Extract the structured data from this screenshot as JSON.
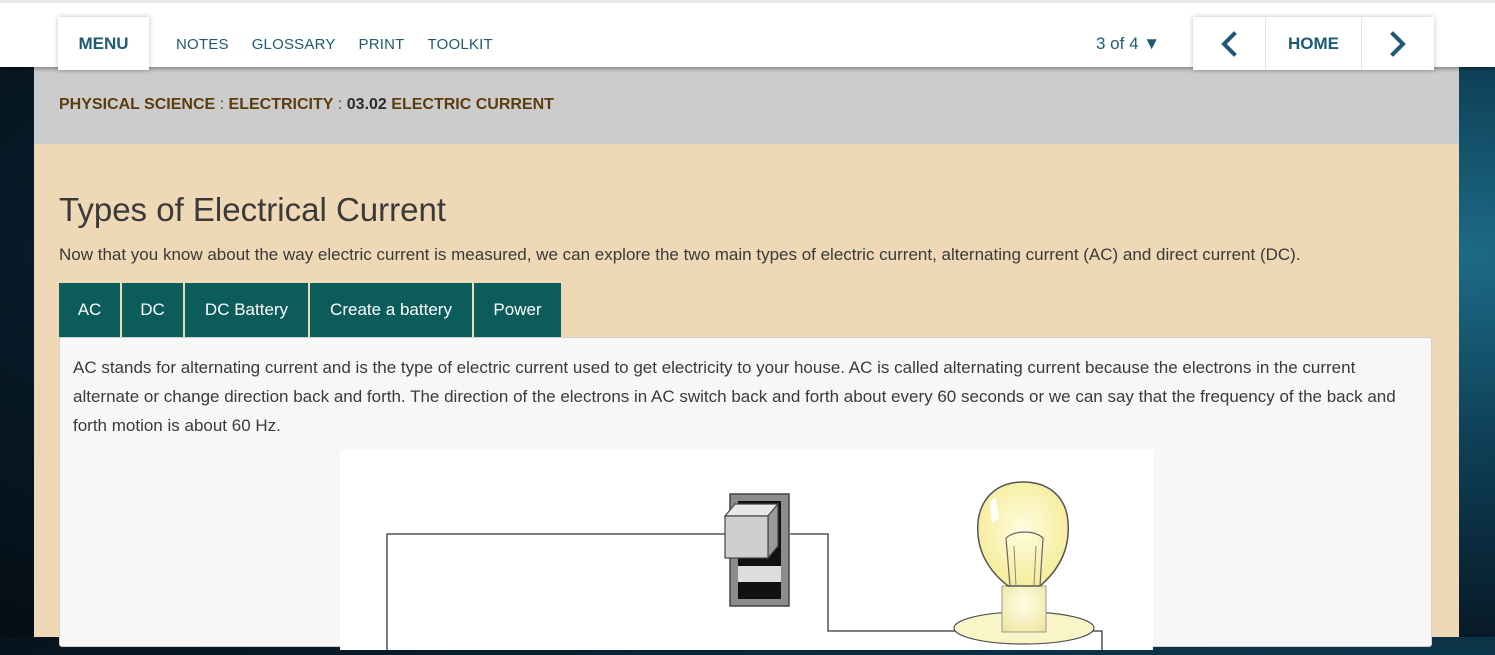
{
  "topbar": {
    "menu_label": "MENU",
    "links": [
      "NOTES",
      "GLOSSARY",
      "PRINT",
      "TOOLKIT"
    ],
    "pager": "3 of 4 ▼",
    "prev_icon": "chevron-left-icon",
    "home_label": "HOME",
    "next_icon": "chevron-right-icon"
  },
  "breadcrumb": {
    "subject": "PHYSICAL SCIENCE",
    "sep1": " : ",
    "unit": "ELECTRICITY",
    "sep2": " : ",
    "lesson_number": "03.02",
    "lesson_title": "ELECTRIC CURRENT"
  },
  "main": {
    "title": "Types of Electrical Current",
    "intro": "Now that you know about the way electric current is measured, we can explore the two main types of electric current, alternating current (AC) and direct current (DC).",
    "tabs": [
      "AC",
      "DC",
      "DC Battery",
      "Create a battery",
      "Power"
    ],
    "active_tab": "AC",
    "panel_text": "AC stands for alternating current and is the type of electric current used to get electricity to your house. AC is called alternating current because the electrons in the current alternate or change direction back and forth. The direction of the electrons in AC switch back and forth about every 60 seconds or we can say that the frequency of the back and forth motion is about 60 Hz."
  },
  "colors": {
    "accent": "#1e5a73",
    "tab_bg": "#0d5c5c",
    "page_bg": "#eed8b6",
    "breadcrumb_bg": "#cccccc",
    "breadcrumb_text": "#5c3d0d"
  }
}
